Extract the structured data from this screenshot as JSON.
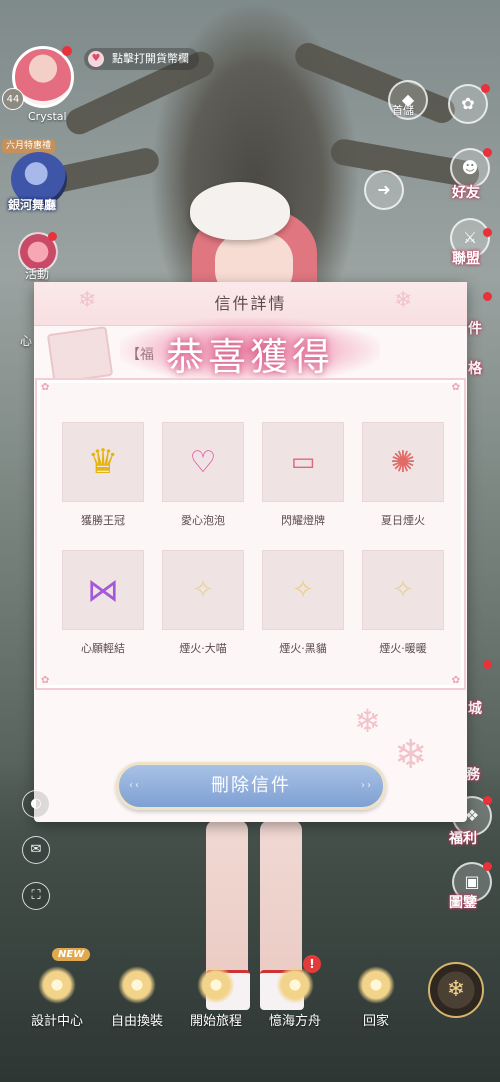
{
  "player": {
    "name": "Crystal",
    "level": "44"
  },
  "hint": {
    "text": "點擊打開貨幣欄"
  },
  "left_menu": {
    "june_tag": "六月特惠禮",
    "galaxy_label": "銀河舞廳",
    "activity_label": "活動",
    "heart_label": "心"
  },
  "right_menu": {
    "first_purchase": "首儲",
    "friends": "好友",
    "alliance": "聯盟",
    "mail": "件",
    "grid": "格",
    "city": "城",
    "tasks": "務",
    "welfare": "福利",
    "codex": "圖鑒"
  },
  "mail": {
    "title": "信件詳情",
    "subject": "【福",
    "congrats": "恭喜獲得",
    "delete_label": "刪除信件",
    "items": [
      {
        "name": "獲勝王冠",
        "icon": "crown-icon"
      },
      {
        "name": "愛心泡泡",
        "icon": "heart-bubble-icon"
      },
      {
        "name": "閃耀燈牌",
        "icon": "light-sign-icon"
      },
      {
        "name": "夏日煙火",
        "icon": "firework-icon"
      },
      {
        "name": "心願輕結",
        "icon": "bow-icon"
      },
      {
        "name": "煙火·大喵",
        "icon": "firework-cat-icon"
      },
      {
        "name": "煙火·黑貓",
        "icon": "firework-black-cat-icon"
      },
      {
        "name": "煙火·暖暖",
        "icon": "firework-nuan-icon"
      }
    ]
  },
  "bottom_nav": {
    "new_tag": "NEW",
    "items": [
      "設計中心",
      "自由換裝",
      "開始旅程",
      "憶海方舟",
      "回家"
    ],
    "alert": "!"
  },
  "colors": {
    "accent_pink": "#e07aa0",
    "button_blue": "#7ea0d3",
    "red_dot": "#e8313a"
  }
}
